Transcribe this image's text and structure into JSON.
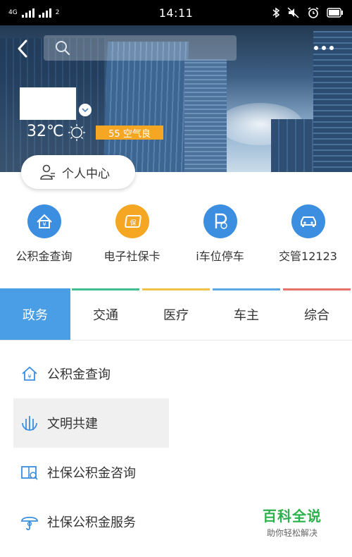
{
  "status_bar": {
    "network_1": "4G",
    "network_2": "2",
    "time": "14:11"
  },
  "header": {
    "search_placeholder": ""
  },
  "weather": {
    "temperature": "32℃",
    "aqi": "55 空气良"
  },
  "personal_center_label": "个人中心",
  "quick_services": [
    {
      "label": "公积金查询",
      "icon": "house-fund-icon",
      "color": "#3b8ee0"
    },
    {
      "label": "电子社保卡",
      "icon": "social-security-card-icon",
      "color": "#f5a623"
    },
    {
      "label": "i车位停车",
      "icon": "parking-icon",
      "color": "#3b8ee0"
    },
    {
      "label": "交管12123",
      "icon": "car-icon",
      "color": "#3b8ee0"
    }
  ],
  "tabs": [
    {
      "label": "政务",
      "accent": "#4a9ee5",
      "active": true
    },
    {
      "label": "交通",
      "accent": "#3fbf8f",
      "active": false
    },
    {
      "label": "医疗",
      "accent": "#f0c24b",
      "active": false
    },
    {
      "label": "车主",
      "accent": "#5aa7e6",
      "active": false
    },
    {
      "label": "综合",
      "accent": "#e8716b",
      "active": false
    }
  ],
  "list_items": [
    {
      "label": "公积金查询",
      "icon": "house-fund-icon"
    },
    {
      "label": "文明共建",
      "icon": "civilization-icon"
    },
    {
      "label": "社保公积金咨询",
      "icon": "book-search-icon"
    },
    {
      "label": "社保公积金服务",
      "icon": "umbrella-icon"
    }
  ],
  "watermark": {
    "title": "百科全说",
    "subtitle": "助你轻松解决"
  },
  "colors": {
    "accent_blue": "#4a9ee5",
    "badge_orange": "#f5a623",
    "watermark_green": "#2bb24c"
  }
}
